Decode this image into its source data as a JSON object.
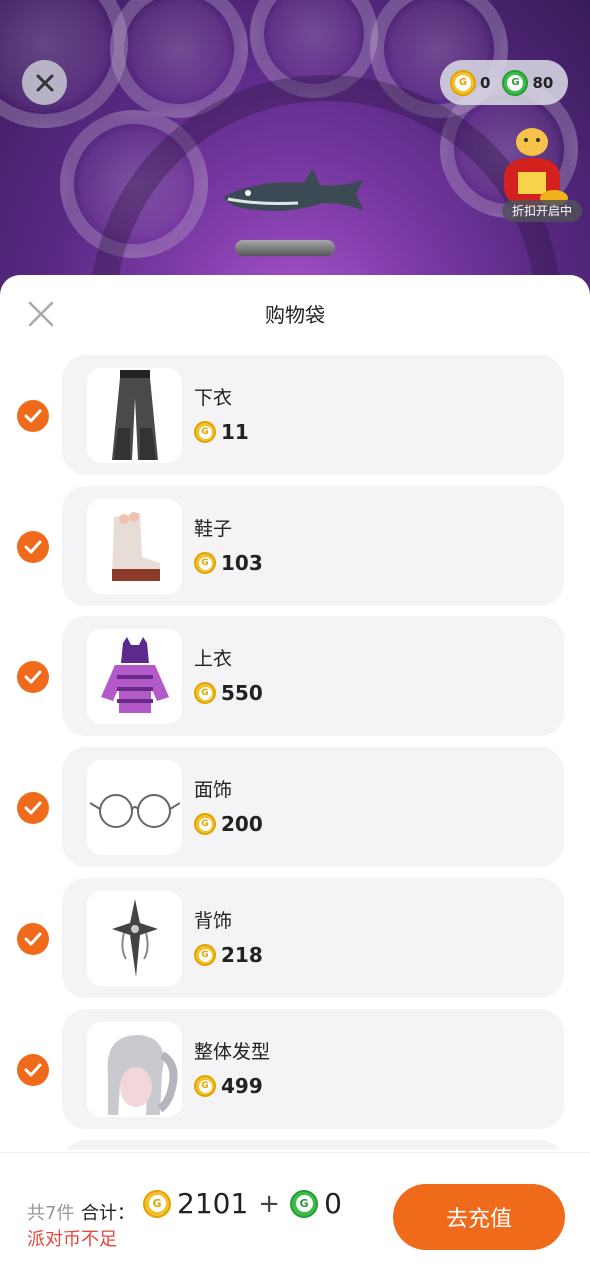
{
  "header": {
    "gold_balance": "0",
    "green_balance": "80",
    "promo_label": "折扣开启中"
  },
  "sheet": {
    "title": "购物袋"
  },
  "items": [
    {
      "name": "下衣",
      "price": "11",
      "thumb_icon": "pants-icon"
    },
    {
      "name": "鞋子",
      "price": "103",
      "thumb_icon": "boots-icon"
    },
    {
      "name": "上衣",
      "price": "550",
      "thumb_icon": "hoodie-icon"
    },
    {
      "name": "面饰",
      "price": "200",
      "thumb_icon": "glasses-icon"
    },
    {
      "name": "背饰",
      "price": "218",
      "thumb_icon": "cross-icon"
    },
    {
      "name": "整体发型",
      "price": "499",
      "thumb_icon": "hair-icon"
    }
  ],
  "footer": {
    "count_label": "共7件",
    "total_label": "合计：",
    "gold_total": "2101",
    "plus": "+",
    "green_total": "0",
    "warning": "派对币不足",
    "recharge_label": "去充值"
  },
  "colors": {
    "accent": "#f06a1c",
    "warning": "#e5453c",
    "gold_coin": "#f2c12e",
    "green_coin": "#3bbd4a"
  }
}
